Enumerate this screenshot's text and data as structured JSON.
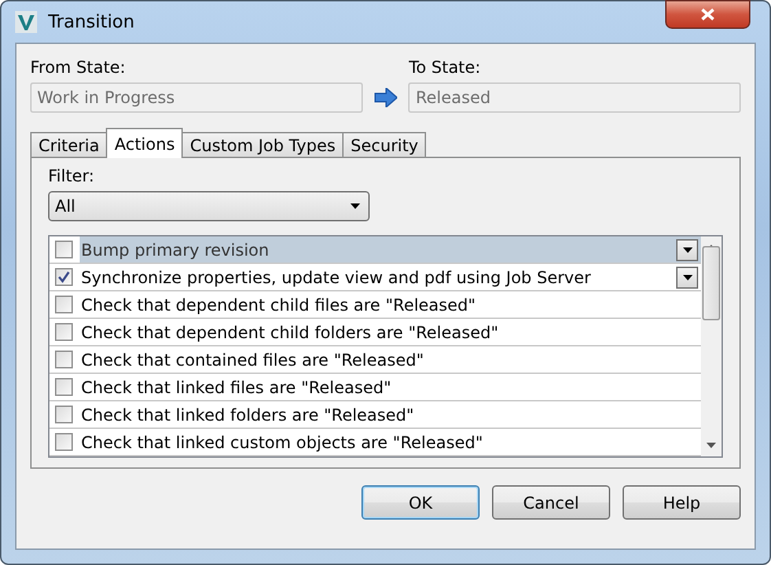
{
  "window": {
    "title": "Transition"
  },
  "from_state": {
    "label": "From State:",
    "value": "Work in Progress"
  },
  "to_state": {
    "label": "To State:",
    "value": "Released"
  },
  "tabs": [
    {
      "label": "Criteria",
      "selected": false
    },
    {
      "label": "Actions",
      "selected": true
    },
    {
      "label": "Custom Job Types",
      "selected": false
    },
    {
      "label": "Security",
      "selected": false
    }
  ],
  "filter": {
    "label": "Filter:",
    "value": "All"
  },
  "actions": [
    {
      "label": "Bump primary revision",
      "checked": false,
      "selected": true,
      "kind": "dropdown"
    },
    {
      "label": "Synchronize properties, update view and pdf using Job Server",
      "checked": true,
      "selected": false,
      "kind": "dropdown"
    },
    {
      "label": "Check that dependent child files are \"Released\"",
      "checked": false,
      "selected": false,
      "kind": "plain"
    },
    {
      "label": "Check that dependent child folders are \"Released\"",
      "checked": false,
      "selected": false,
      "kind": "plain"
    },
    {
      "label": "Check that contained files are \"Released\"",
      "checked": false,
      "selected": false,
      "kind": "plain"
    },
    {
      "label": "Check that linked files are \"Released\"",
      "checked": false,
      "selected": false,
      "kind": "plain"
    },
    {
      "label": "Check that linked folders are \"Released\"",
      "checked": false,
      "selected": false,
      "kind": "plain"
    },
    {
      "label": "Check that linked custom objects are \"Released\"",
      "checked": false,
      "selected": false,
      "kind": "plain"
    }
  ],
  "buttons": [
    {
      "label": "OK",
      "selected": true
    },
    {
      "label": "Cancel",
      "selected": false
    },
    {
      "label": "Help",
      "selected": false
    }
  ]
}
